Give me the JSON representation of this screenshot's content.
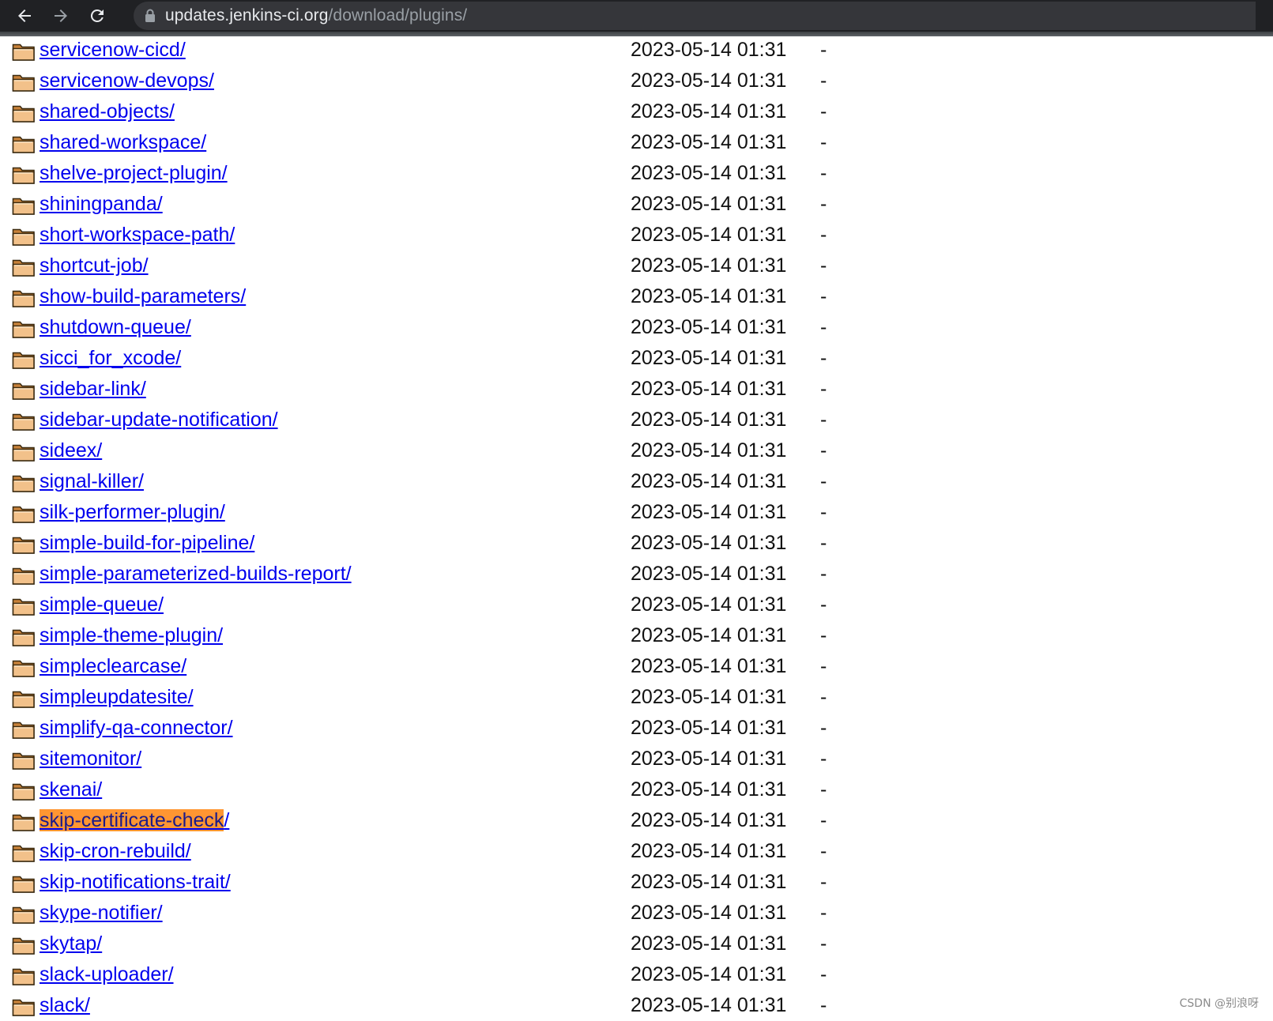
{
  "browser": {
    "url_host": "updates.jenkins-ci.org",
    "url_path": "/download/plugins/",
    "back_icon": "arrow-left-icon",
    "forward_icon": "arrow-right-icon",
    "reload_icon": "reload-icon",
    "lock_icon": "lock-icon"
  },
  "listing": {
    "folder_icon": "folder-icon",
    "link_color": "#0000ee",
    "highlight_color": "#ff9632",
    "rows": [
      {
        "name": "servicenow-cicd/",
        "date": "2023-05-14 01:31",
        "size": "-"
      },
      {
        "name": "servicenow-devops/",
        "date": "2023-05-14 01:31",
        "size": "-"
      },
      {
        "name": "shared-objects/",
        "date": "2023-05-14 01:31",
        "size": "-"
      },
      {
        "name": "shared-workspace/",
        "date": "2023-05-14 01:31",
        "size": "-"
      },
      {
        "name": "shelve-project-plugin/",
        "date": "2023-05-14 01:31",
        "size": "-"
      },
      {
        "name": "shiningpanda/",
        "date": "2023-05-14 01:31",
        "size": "-"
      },
      {
        "name": "short-workspace-path/",
        "date": "2023-05-14 01:31",
        "size": "-"
      },
      {
        "name": "shortcut-job/",
        "date": "2023-05-14 01:31",
        "size": "-"
      },
      {
        "name": "show-build-parameters/",
        "date": "2023-05-14 01:31",
        "size": "-"
      },
      {
        "name": "shutdown-queue/",
        "date": "2023-05-14 01:31",
        "size": "-"
      },
      {
        "name": "sicci_for_xcode/",
        "date": "2023-05-14 01:31",
        "size": "-"
      },
      {
        "name": "sidebar-link/",
        "date": "2023-05-14 01:31",
        "size": "-"
      },
      {
        "name": "sidebar-update-notification/",
        "date": "2023-05-14 01:31",
        "size": "-"
      },
      {
        "name": "sideex/",
        "date": "2023-05-14 01:31",
        "size": "-"
      },
      {
        "name": "signal-killer/",
        "date": "2023-05-14 01:31",
        "size": "-"
      },
      {
        "name": "silk-performer-plugin/",
        "date": "2023-05-14 01:31",
        "size": "-"
      },
      {
        "name": "simple-build-for-pipeline/",
        "date": "2023-05-14 01:31",
        "size": "-"
      },
      {
        "name": "simple-parameterized-builds-report/",
        "date": "2023-05-14 01:31",
        "size": "-"
      },
      {
        "name": "simple-queue/",
        "date": "2023-05-14 01:31",
        "size": "-"
      },
      {
        "name": "simple-theme-plugin/",
        "date": "2023-05-14 01:31",
        "size": "-"
      },
      {
        "name": "simpleclearcase/",
        "date": "2023-05-14 01:31",
        "size": "-"
      },
      {
        "name": "simpleupdatesite/",
        "date": "2023-05-14 01:31",
        "size": "-"
      },
      {
        "name": "simplify-qa-connector/",
        "date": "2023-05-14 01:31",
        "size": "-"
      },
      {
        "name": "sitemonitor/",
        "date": "2023-05-14 01:31",
        "size": "-"
      },
      {
        "name": "skenai/",
        "date": "2023-05-14 01:31",
        "size": "-"
      },
      {
        "name": "skip-certificate-check/",
        "date": "2023-05-14 01:31",
        "size": "-",
        "highlight": "skip-certificate-check"
      },
      {
        "name": "skip-cron-rebuild/",
        "date": "2023-05-14 01:31",
        "size": "-"
      },
      {
        "name": "skip-notifications-trait/",
        "date": "2023-05-14 01:31",
        "size": "-"
      },
      {
        "name": "skype-notifier/",
        "date": "2023-05-14 01:31",
        "size": "-"
      },
      {
        "name": "skytap/",
        "date": "2023-05-14 01:31",
        "size": "-"
      },
      {
        "name": "slack-uploader/",
        "date": "2023-05-14 01:31",
        "size": "-"
      },
      {
        "name": "slack/",
        "date": "2023-05-14 01:31",
        "size": "-"
      }
    ]
  },
  "watermark": "CSDN @别浪呀"
}
